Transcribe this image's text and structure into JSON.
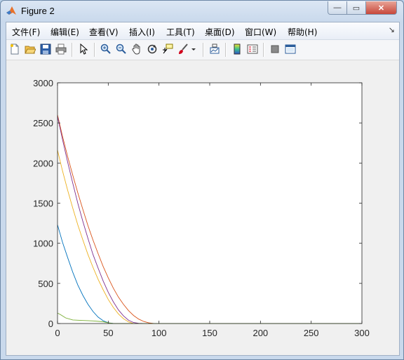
{
  "window": {
    "title": "Figure 2"
  },
  "window_buttons": {
    "minimize": "—",
    "maximize": "▭",
    "close": "✕"
  },
  "menu": [
    {
      "label": "文件(F)"
    },
    {
      "label": "编辑(E)"
    },
    {
      "label": "查看(V)"
    },
    {
      "label": "插入(I)"
    },
    {
      "label": "工具(T)"
    },
    {
      "label": "桌面(D)"
    },
    {
      "label": "窗口(W)"
    },
    {
      "label": "帮助(H)"
    }
  ],
  "menu_overflow": "↘",
  "toolbar": {
    "icons": [
      "new-figure-icon",
      "open-file-icon",
      "save-icon",
      "print-icon",
      "select-arrow-icon",
      "zoom-in-icon",
      "zoom-out-icon",
      "pan-hand-icon",
      "rotate-3d-icon",
      "data-cursor-icon",
      "brush-icon",
      "brush-dropdown-icon",
      "link-plot-icon",
      "colorbar-icon",
      "legend-icon",
      "hide-plot-tools-icon",
      "show-plot-tools-icon"
    ]
  },
  "chart_data": {
    "type": "line",
    "xlim": [
      0,
      300
    ],
    "ylim": [
      0,
      3000
    ],
    "xticks": [
      0,
      50,
      100,
      150,
      200,
      250,
      300
    ],
    "yticks": [
      0,
      500,
      1000,
      1500,
      2000,
      2500,
      3000
    ],
    "grid": false,
    "series": [
      {
        "color": "#0072bd",
        "x": [
          0,
          5,
          10,
          15,
          20,
          25,
          30,
          35,
          40,
          45,
          50,
          55,
          300
        ],
        "y": [
          1230,
          1010,
          820,
          640,
          480,
          350,
          240,
          150,
          80,
          35,
          10,
          0,
          0
        ]
      },
      {
        "color": "#d95319",
        "x": [
          0,
          5,
          10,
          15,
          20,
          25,
          30,
          35,
          40,
          45,
          50,
          55,
          60,
          65,
          70,
          75,
          80,
          85,
          90,
          95,
          300
        ],
        "y": [
          2600,
          2330,
          2080,
          1850,
          1630,
          1420,
          1220,
          1040,
          870,
          710,
          570,
          440,
          330,
          240,
          160,
          100,
          55,
          25,
          8,
          0,
          0
        ]
      },
      {
        "color": "#edb120",
        "x": [
          0,
          5,
          10,
          15,
          20,
          25,
          30,
          35,
          40,
          45,
          50,
          55,
          60,
          65,
          70,
          75,
          300
        ],
        "y": [
          2160,
          1900,
          1660,
          1440,
          1230,
          1040,
          860,
          700,
          550,
          420,
          300,
          200,
          120,
          60,
          20,
          0,
          0
        ]
      },
      {
        "color": "#7e2f8e",
        "x": [
          0,
          5,
          10,
          15,
          20,
          25,
          30,
          35,
          40,
          45,
          50,
          55,
          60,
          65,
          70,
          75,
          80,
          85,
          300
        ],
        "y": [
          2580,
          2290,
          2010,
          1750,
          1500,
          1270,
          1060,
          860,
          690,
          530,
          390,
          270,
          170,
          95,
          40,
          12,
          3,
          0,
          0
        ]
      },
      {
        "color": "#77ac30",
        "x": [
          0,
          3,
          8,
          15,
          25,
          35,
          45,
          50,
          55,
          300
        ],
        "y": [
          130,
          110,
          70,
          45,
          38,
          32,
          22,
          8,
          0,
          0
        ]
      }
    ]
  }
}
